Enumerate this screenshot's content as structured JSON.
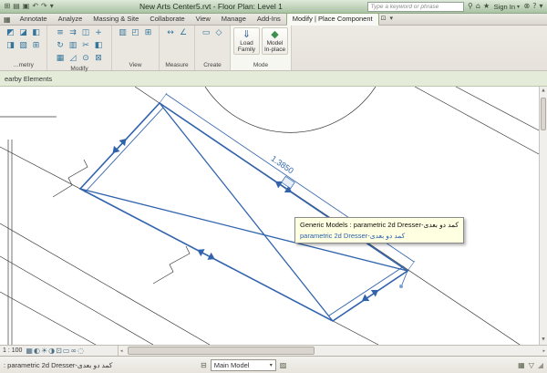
{
  "titlebar": {
    "title": "New Arts Center5.rvt - Floor Plan: Level 1",
    "qat_icons": [
      {
        "name": "app-grid-icon",
        "glyph": "⊞"
      },
      {
        "name": "open-icon",
        "glyph": "▤"
      },
      {
        "name": "save-icon",
        "glyph": "▣"
      },
      {
        "name": "undo-icon",
        "glyph": "↶"
      },
      {
        "name": "redo-icon",
        "glyph": "↷"
      },
      {
        "name": "qat-caret-icon",
        "glyph": "▾"
      }
    ],
    "search_placeholder": "Type a keyword or phrase",
    "infocenter_icons": [
      {
        "name": "search-icon",
        "glyph": "⚲"
      },
      {
        "name": "subscription-center-icon",
        "glyph": "⌂"
      },
      {
        "name": "favorites-icon",
        "glyph": "★"
      }
    ],
    "sign_in_label": "Sign In",
    "sign_in_caret": "▾",
    "right_icons": [
      {
        "name": "exchange-apps-icon",
        "glyph": "⊗"
      },
      {
        "name": "help-icon",
        "glyph": "?"
      },
      {
        "name": "help-caret-icon",
        "glyph": "▾"
      }
    ]
  },
  "tab_bar": {
    "app_icon_glyph": "▦",
    "tabs": [
      "Annotate",
      "Analyze",
      "Massing & Site",
      "Collaborate",
      "View",
      "Manage",
      "Add-Ins"
    ],
    "active_tab": "Modify | Place Component",
    "panel_toggle_glyph": "⊡",
    "panel_toggle_caret": "▾"
  },
  "ribbon": {
    "panels": [
      {
        "label": "…metry",
        "icons": [
          {
            "name": "cut-geometry-icon",
            "glyph": "◩"
          },
          {
            "name": "join-geometry-icon",
            "glyph": "◪"
          },
          {
            "name": "cope-icon",
            "glyph": "◧"
          },
          {
            "name": "apply-coping-icon",
            "glyph": "◨"
          },
          {
            "name": "wall-joins-icon",
            "glyph": "▧"
          },
          {
            "name": "demolish-icon",
            "glyph": "⊞"
          }
        ]
      },
      {
        "label": "Modify",
        "icons": [
          {
            "name": "align-icon",
            "glyph": "≡"
          },
          {
            "name": "offset-icon",
            "glyph": "⇉"
          },
          {
            "name": "mirror-icon",
            "glyph": "◫"
          },
          {
            "name": "move-icon",
            "glyph": "+"
          },
          {
            "name": "rotate-icon",
            "glyph": "↻"
          },
          {
            "name": "copy-icon",
            "glyph": "▥"
          },
          {
            "name": "trim-icon",
            "glyph": "✂"
          },
          {
            "name": "split-icon",
            "glyph": "◧"
          },
          {
            "name": "array-icon",
            "glyph": "▦"
          },
          {
            "name": "scale-icon",
            "glyph": "◿"
          },
          {
            "name": "pin-icon",
            "glyph": "⊙"
          },
          {
            "name": "delete-icon",
            "glyph": "⊠"
          }
        ]
      },
      {
        "label": "View",
        "icons": [
          {
            "name": "thin-lines-icon",
            "glyph": "▥"
          },
          {
            "name": "show-hidden-lines-icon",
            "glyph": "◰"
          },
          {
            "name": "switch-windows-icon",
            "glyph": "⊞"
          }
        ]
      },
      {
        "label": "Measure",
        "icons": [
          {
            "name": "measure-icon",
            "glyph": "↔"
          },
          {
            "name": "dimension-icon",
            "glyph": "∠"
          }
        ]
      },
      {
        "label": "Create",
        "icons": [
          {
            "name": "create-group-icon",
            "glyph": "▭"
          },
          {
            "name": "create-similar-icon",
            "glyph": "◇"
          }
        ]
      }
    ],
    "mode_panel": {
      "label": "Mode",
      "buttons": [
        {
          "name": "load-family-button",
          "glyph": "⇓",
          "line1": "Load",
          "line2": "Family"
        },
        {
          "name": "model-in-place-button",
          "glyph": "◆",
          "line1": "Model",
          "line2": "In-place"
        }
      ]
    }
  },
  "options_bar": {
    "text": "earby Elements"
  },
  "canvas": {
    "dimension_value": "1.3850",
    "tooltip": {
      "line1": "Generic Models : parametric 2d Dresser-کمد دو بعدی",
      "line2": "parametric 2d Dresser-کمد دو بعدی"
    }
  },
  "view_bar": {
    "scale": "1 : 100",
    "icons": [
      {
        "name": "detail-level-icon",
        "glyph": "▦"
      },
      {
        "name": "visual-style-icon",
        "glyph": "◐"
      },
      {
        "name": "sun-path-icon",
        "glyph": "☀"
      },
      {
        "name": "shadows-icon",
        "glyph": "◑"
      },
      {
        "name": "crop-view-icon",
        "glyph": "⊡"
      },
      {
        "name": "crop-region-icon",
        "glyph": "▭"
      },
      {
        "name": "temporary-hide-icon",
        "glyph": "∞"
      },
      {
        "name": "reveal-hidden-icon",
        "glyph": "◌"
      }
    ]
  },
  "scrollbar": {
    "up": "▲",
    "down": "▼",
    "left": "◂",
    "right": "▸"
  },
  "status_bar": {
    "message": ": parametric 2d Dresser-کمد دو بعدی",
    "design_options_icon_glyph": "⊟",
    "design_option_value": "Main Model",
    "design_option_caret": "▾",
    "exclude_options_glyph": "▨",
    "editable_only_glyph": "▦",
    "filter_glyph": "▽",
    "grip_glyph": "◢"
  }
}
